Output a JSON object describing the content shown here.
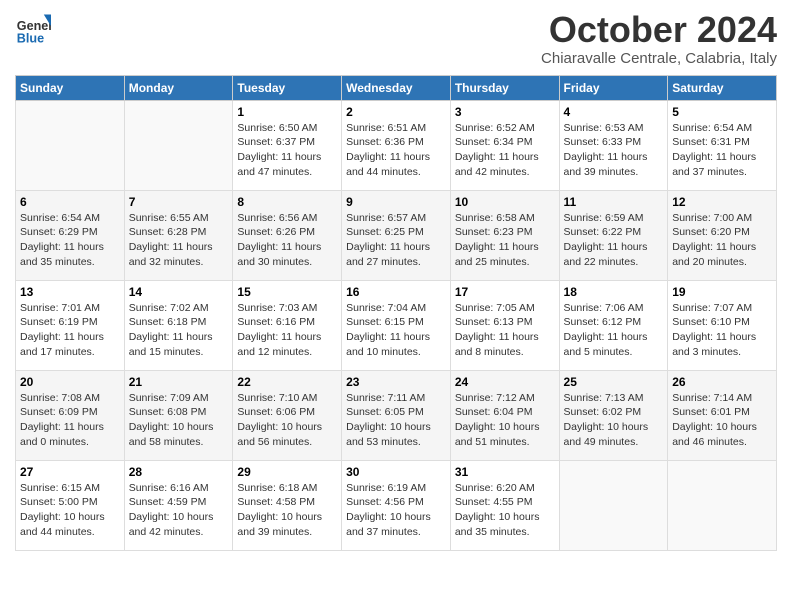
{
  "header": {
    "logo": {
      "general": "General",
      "blue": "Blue"
    },
    "title": "October 2024",
    "location": "Chiaravalle Centrale, Calabria, Italy"
  },
  "days_of_week": [
    "Sunday",
    "Monday",
    "Tuesday",
    "Wednesday",
    "Thursday",
    "Friday",
    "Saturday"
  ],
  "weeks": [
    [
      null,
      null,
      {
        "day": 1,
        "sunrise": "6:50 AM",
        "sunset": "6:37 PM",
        "daylight": "11 hours and 47 minutes."
      },
      {
        "day": 2,
        "sunrise": "6:51 AM",
        "sunset": "6:36 PM",
        "daylight": "11 hours and 44 minutes."
      },
      {
        "day": 3,
        "sunrise": "6:52 AM",
        "sunset": "6:34 PM",
        "daylight": "11 hours and 42 minutes."
      },
      {
        "day": 4,
        "sunrise": "6:53 AM",
        "sunset": "6:33 PM",
        "daylight": "11 hours and 39 minutes."
      },
      {
        "day": 5,
        "sunrise": "6:54 AM",
        "sunset": "6:31 PM",
        "daylight": "11 hours and 37 minutes."
      }
    ],
    [
      {
        "day": 6,
        "sunrise": "6:54 AM",
        "sunset": "6:29 PM",
        "daylight": "11 hours and 35 minutes."
      },
      {
        "day": 7,
        "sunrise": "6:55 AM",
        "sunset": "6:28 PM",
        "daylight": "11 hours and 32 minutes."
      },
      {
        "day": 8,
        "sunrise": "6:56 AM",
        "sunset": "6:26 PM",
        "daylight": "11 hours and 30 minutes."
      },
      {
        "day": 9,
        "sunrise": "6:57 AM",
        "sunset": "6:25 PM",
        "daylight": "11 hours and 27 minutes."
      },
      {
        "day": 10,
        "sunrise": "6:58 AM",
        "sunset": "6:23 PM",
        "daylight": "11 hours and 25 minutes."
      },
      {
        "day": 11,
        "sunrise": "6:59 AM",
        "sunset": "6:22 PM",
        "daylight": "11 hours and 22 minutes."
      },
      {
        "day": 12,
        "sunrise": "7:00 AM",
        "sunset": "6:20 PM",
        "daylight": "11 hours and 20 minutes."
      }
    ],
    [
      {
        "day": 13,
        "sunrise": "7:01 AM",
        "sunset": "6:19 PM",
        "daylight": "11 hours and 17 minutes."
      },
      {
        "day": 14,
        "sunrise": "7:02 AM",
        "sunset": "6:18 PM",
        "daylight": "11 hours and 15 minutes."
      },
      {
        "day": 15,
        "sunrise": "7:03 AM",
        "sunset": "6:16 PM",
        "daylight": "11 hours and 12 minutes."
      },
      {
        "day": 16,
        "sunrise": "7:04 AM",
        "sunset": "6:15 PM",
        "daylight": "11 hours and 10 minutes."
      },
      {
        "day": 17,
        "sunrise": "7:05 AM",
        "sunset": "6:13 PM",
        "daylight": "11 hours and 8 minutes."
      },
      {
        "day": 18,
        "sunrise": "7:06 AM",
        "sunset": "6:12 PM",
        "daylight": "11 hours and 5 minutes."
      },
      {
        "day": 19,
        "sunrise": "7:07 AM",
        "sunset": "6:10 PM",
        "daylight": "11 hours and 3 minutes."
      }
    ],
    [
      {
        "day": 20,
        "sunrise": "7:08 AM",
        "sunset": "6:09 PM",
        "daylight": "11 hours and 0 minutes."
      },
      {
        "day": 21,
        "sunrise": "7:09 AM",
        "sunset": "6:08 PM",
        "daylight": "10 hours and 58 minutes."
      },
      {
        "day": 22,
        "sunrise": "7:10 AM",
        "sunset": "6:06 PM",
        "daylight": "10 hours and 56 minutes."
      },
      {
        "day": 23,
        "sunrise": "7:11 AM",
        "sunset": "6:05 PM",
        "daylight": "10 hours and 53 minutes."
      },
      {
        "day": 24,
        "sunrise": "7:12 AM",
        "sunset": "6:04 PM",
        "daylight": "10 hours and 51 minutes."
      },
      {
        "day": 25,
        "sunrise": "7:13 AM",
        "sunset": "6:02 PM",
        "daylight": "10 hours and 49 minutes."
      },
      {
        "day": 26,
        "sunrise": "7:14 AM",
        "sunset": "6:01 PM",
        "daylight": "10 hours and 46 minutes."
      }
    ],
    [
      {
        "day": 27,
        "sunrise": "6:15 AM",
        "sunset": "5:00 PM",
        "daylight": "10 hours and 44 minutes."
      },
      {
        "day": 28,
        "sunrise": "6:16 AM",
        "sunset": "4:59 PM",
        "daylight": "10 hours and 42 minutes."
      },
      {
        "day": 29,
        "sunrise": "6:18 AM",
        "sunset": "4:58 PM",
        "daylight": "10 hours and 39 minutes."
      },
      {
        "day": 30,
        "sunrise": "6:19 AM",
        "sunset": "4:56 PM",
        "daylight": "10 hours and 37 minutes."
      },
      {
        "day": 31,
        "sunrise": "6:20 AM",
        "sunset": "4:55 PM",
        "daylight": "10 hours and 35 minutes."
      },
      null,
      null
    ]
  ]
}
